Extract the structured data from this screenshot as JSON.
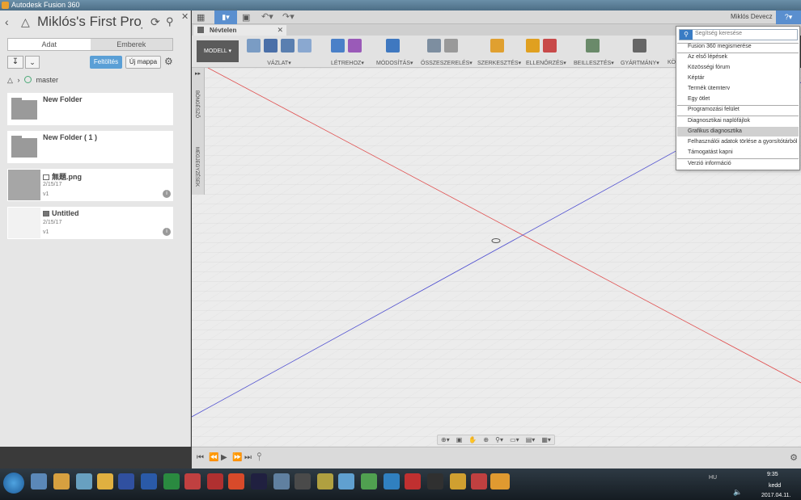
{
  "window": {
    "title": "Autodesk Fusion 360"
  },
  "left_panel": {
    "project_title": "Miklós's First Proj…",
    "tabs": [
      "Adat",
      "Emberek"
    ],
    "upload_label": "Feltöltés",
    "new_folder_label": "Új mappa",
    "branch": "master",
    "items": [
      {
        "name": "New Folder",
        "date": "",
        "version": ""
      },
      {
        "name": "New Folder ( 1 )",
        "date": "",
        "version": ""
      },
      {
        "name": "無題.png",
        "date": "2/15/17",
        "version": "v1"
      },
      {
        "name": "Untitled",
        "date": "2/15/17",
        "version": "v1"
      }
    ]
  },
  "topbar": {
    "user": "Miklós Devecz"
  },
  "document_tab": {
    "label": "Névtelen"
  },
  "ribbon": {
    "mode": "MODELL",
    "groups": [
      "VÁZLAT",
      "LÉTREHOZ",
      "MÓDOSÍTÁS",
      "ÖSSZESZERELÉS",
      "SZERKESZTÉS",
      "ELLENŐRZÉS",
      "BEILLESZTÉS",
      "GYÁRTMÁNY",
      "KÖ"
    ]
  },
  "browser_strip": {
    "browser": "BÖNGÉSZŐ",
    "comments": "MEGJEGYZÉSEK"
  },
  "help_menu": {
    "search_placeholder": "Segítség keresése",
    "items": [
      "Fusion 360 megismerése",
      "Az első lépések",
      "Közösségi fórum",
      "Képtár",
      "Termék ütemterv",
      "Egy ötlet",
      "Programozási felület",
      "Diagnosztikai naplófájlok",
      "Grafikus diagnosztika",
      "Felhasználói adatok törlése a gyorsítótárból",
      "Támogatást kapni",
      "Verzió információ"
    ],
    "highlighted": "Grafikus diagnosztika"
  },
  "taskbar": {
    "time": "9:35",
    "day": "kedd",
    "date": "2017.04.11.",
    "lang": "HU"
  },
  "colors": {
    "accent": "#5a8fcf",
    "upload": "#5a9fd6",
    "x_axis": "#e05050",
    "y_axis": "#5050d0"
  }
}
